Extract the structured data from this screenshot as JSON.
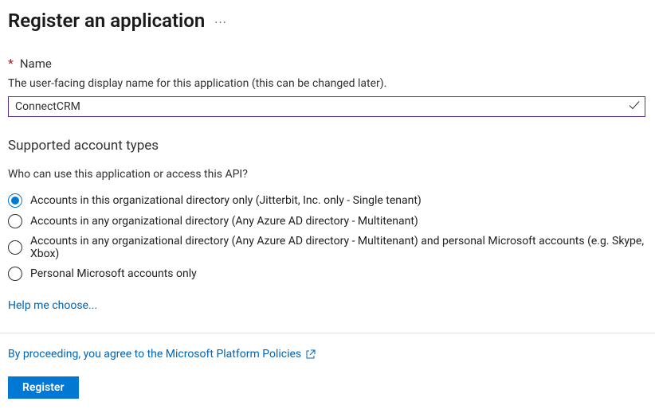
{
  "pageTitle": "Register an application",
  "nameField": {
    "label": "Name",
    "hint": "The user-facing display name for this application (this can be changed later).",
    "value": "ConnectCRM"
  },
  "accountTypes": {
    "heading": "Supported account types",
    "question": "Who can use this application or access this API?",
    "options": [
      "Accounts in this organizational directory only (Jitterbit, Inc. only - Single tenant)",
      "Accounts in any organizational directory (Any Azure AD directory - Multitenant)",
      "Accounts in any organizational directory (Any Azure AD directory - Multitenant) and personal Microsoft accounts (e.g. Skype, Xbox)",
      "Personal Microsoft accounts only"
    ],
    "selectedIndex": 0,
    "helpLink": "Help me choose..."
  },
  "consentText": "By proceeding, you agree to the Microsoft Platform Policies",
  "registerLabel": "Register"
}
